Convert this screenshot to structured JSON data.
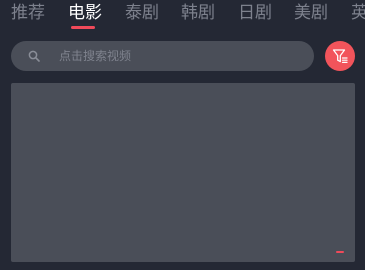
{
  "tabs": [
    {
      "label": "推荐",
      "active": false
    },
    {
      "label": "电影",
      "active": true
    },
    {
      "label": "泰剧",
      "active": false
    },
    {
      "label": "韩剧",
      "active": false
    },
    {
      "label": "日剧",
      "active": false
    },
    {
      "label": "美剧",
      "active": false
    },
    {
      "label": "英",
      "active": false
    }
  ],
  "search": {
    "placeholder": "点击搜索视频",
    "value": ""
  },
  "icons": {
    "search": "search-icon",
    "filter": "filter-icon"
  },
  "colors": {
    "background": "#242834",
    "surface": "#4a4e58",
    "accent": "#f04a5a",
    "tab_inactive": "#7d818d",
    "tab_active": "#ffffff"
  }
}
